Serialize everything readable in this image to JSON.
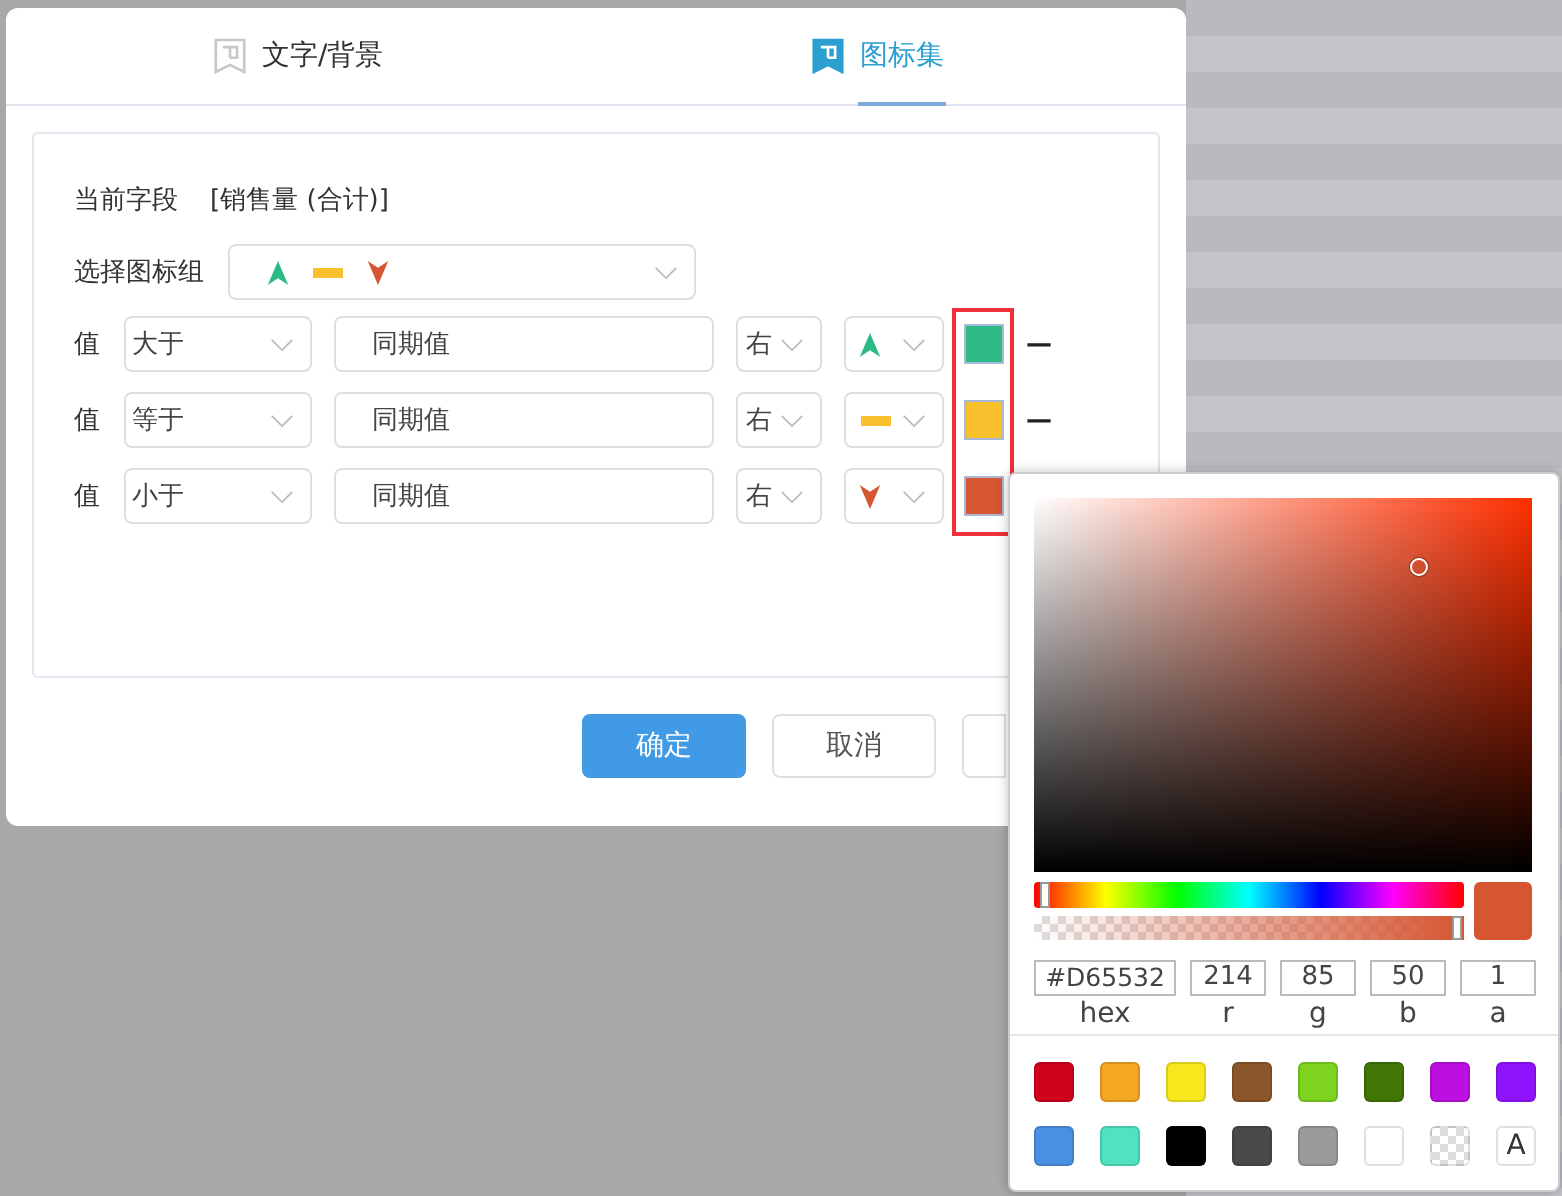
{
  "tabs": [
    {
      "label": "文字/背景",
      "selected": false
    },
    {
      "label": "图标集",
      "selected": true
    }
  ],
  "field": {
    "label": "当前字段",
    "value": "[销售量 (合计)]"
  },
  "icon_group": {
    "label": "选择图标组",
    "icons": [
      {
        "kind": "up",
        "color": "#2dba85"
      },
      {
        "kind": "flat",
        "color": "#f8c02d"
      },
      {
        "kind": "down",
        "color": "#d65532"
      }
    ]
  },
  "rules": [
    {
      "label": "值",
      "operator": "大于",
      "value": "同期值",
      "position": "右",
      "icon": {
        "kind": "up",
        "color": "#2dba85"
      },
      "color": "#2dba85",
      "suffix": "—"
    },
    {
      "label": "值",
      "operator": "等于",
      "value": "同期值",
      "position": "右",
      "icon": {
        "kind": "flat",
        "color": "#f8c02d"
      },
      "color": "#f8c02d",
      "suffix": "—"
    },
    {
      "label": "值",
      "operator": "小于",
      "value": "同期值",
      "position": "右",
      "icon": {
        "kind": "down",
        "color": "#d65532"
      },
      "color": "#d65532"
    }
  ],
  "buttons": [
    {
      "label": "确定",
      "kind": "primary"
    },
    {
      "label": "取消",
      "kind": "default"
    },
    {
      "kind": "default"
    }
  ],
  "picker": {
    "saturation": {
      "level": 0.77
    },
    "brightness": {
      "level": 0.82
    },
    "hue": {
      "level": 0.03
    },
    "alpha": {
      "level": 1
    },
    "preview": {
      "color": "#d65532"
    },
    "hex": "#D65532",
    "channels": [
      {
        "value": "214",
        "label": "r"
      },
      {
        "value": "85",
        "label": "g"
      },
      {
        "value": "50",
        "label": "b"
      },
      {
        "value": "1",
        "label": "a"
      }
    ],
    "hex_label": "hex",
    "swatches": [
      {
        "kind": "color",
        "color": "#d0021b"
      },
      {
        "kind": "color",
        "color": "#f5a623"
      },
      {
        "kind": "color",
        "color": "#f8e71c"
      },
      {
        "kind": "color",
        "color": "#8b572a"
      },
      {
        "kind": "color",
        "color": "#7ed321"
      },
      {
        "kind": "color",
        "color": "#417505"
      },
      {
        "kind": "color",
        "color": "#bd10e0"
      },
      {
        "kind": "color",
        "color": "#9013fe"
      },
      {
        "kind": "color",
        "color": "#4a90e2"
      },
      {
        "kind": "color",
        "color": "#50e3c2"
      },
      {
        "kind": "color",
        "color": "#000000"
      },
      {
        "kind": "color",
        "color": "#4a4a4a"
      },
      {
        "kind": "color",
        "color": "#9b9b9b"
      },
      {
        "kind": "color",
        "color": "#ffffff"
      },
      {
        "kind": "transparent"
      },
      {
        "kind": "text",
        "label": "A"
      }
    ]
  }
}
